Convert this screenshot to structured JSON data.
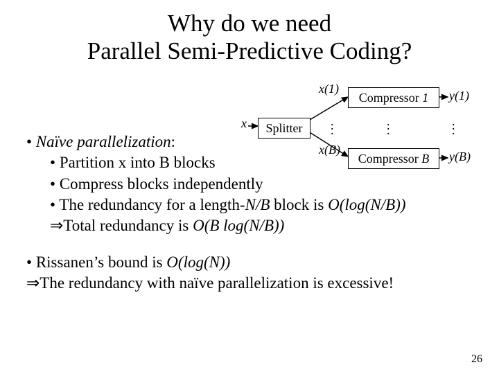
{
  "title": {
    "line1": "Why do we need",
    "line2": "Parallel Semi-Predictive Coding?"
  },
  "diagram": {
    "x": "x",
    "x1": "x(1)",
    "xB": "x(B)",
    "y1": "y(1)",
    "yB": "y(B)",
    "splitter": "Splitter",
    "compressor_prefix": "Compressor",
    "idx1": "1",
    "idxB": "B"
  },
  "body": {
    "naive": "Naïve parallelization",
    "partition": "Partition x into B blocks",
    "compress": "Compress blocks independently",
    "redundancy_a": "The redundancy for a length-",
    "redundancy_b": "N/B",
    "redundancy_c": " block is ",
    "redundancy_d": "O(log(N/B))",
    "therefore": "⇒",
    "total_a": "Total redundancy is ",
    "total_b": "O(B log(N/B))",
    "rissanen_a": "Rissanen’s bound is ",
    "rissanen_b": "O(log(N))",
    "excessive": "The redundancy with naïve parallelization is excessive!"
  },
  "page": "26"
}
